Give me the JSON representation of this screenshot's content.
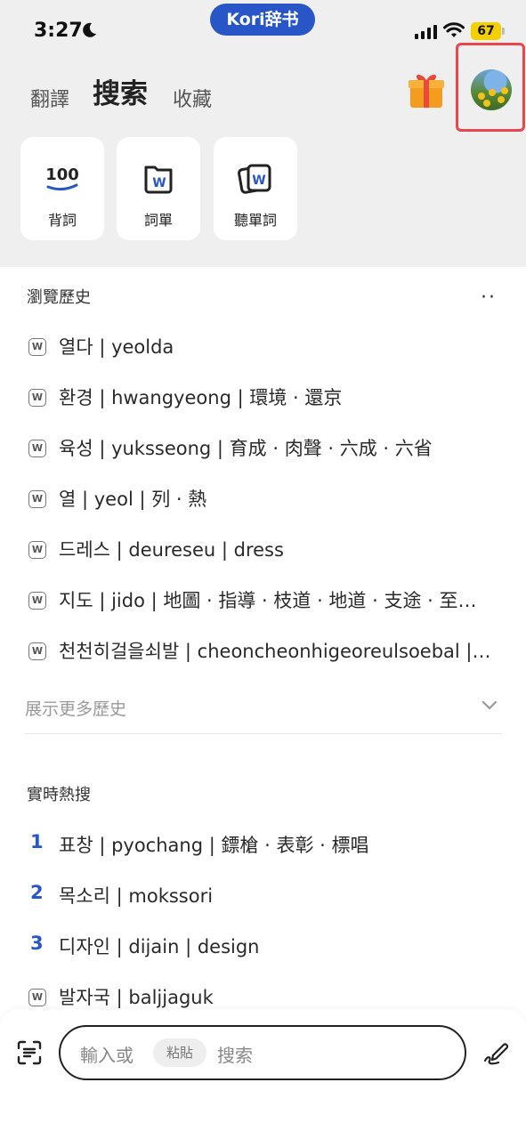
{
  "status_bar": {
    "time": "3:27",
    "app_badge": "Kori辞书",
    "battery": "67"
  },
  "header": {
    "tabs": [
      {
        "label": "翻譯",
        "active": false
      },
      {
        "label": "搜索",
        "active": true
      },
      {
        "label": "收藏",
        "active": false
      }
    ]
  },
  "quick_cards": [
    {
      "label": "背詞",
      "icon": "100-icon"
    },
    {
      "label": "詞單",
      "icon": "word-list-icon"
    },
    {
      "label": "聽單詞",
      "icon": "listen-word-icon"
    }
  ],
  "history": {
    "title": "瀏覽歷史",
    "more_label": "··",
    "items": [
      "열다 | yeolda",
      "환경 | hwangyeong | 環境 · 還京",
      "육성 | yuksseong | 育成 · 肉聲 · 六成 · 六省",
      "열 | yeol | 列 · 熱",
      "드레스 | deureseu | dress",
      "지도 | jido | 地圖 · 指導 · 枝道 · 地道 · 支途 · 至道…",
      "천천히걸을쇠발 | cheoncheonhigeoreulsoebal |…"
    ],
    "show_more": "展示更多歷史"
  },
  "hot": {
    "title": "實時熱搜",
    "items": [
      {
        "rank": "1",
        "text": "표창 | pyochang | 鏢槍 · 表彰 · 標唱"
      },
      {
        "rank": "2",
        "text": "목소리 | mokssori"
      },
      {
        "rank": "3",
        "text": "디자인 | dijain | design"
      },
      {
        "rank": "",
        "text": "발자국 | baljjaguk"
      }
    ]
  },
  "search": {
    "prefix": "輸入或",
    "paste_chip": "粘貼",
    "suffix": "搜索"
  },
  "colors": {
    "accent": "#2856c6",
    "highlight_frame": "#e8484d",
    "header_bg": "#efefef"
  }
}
